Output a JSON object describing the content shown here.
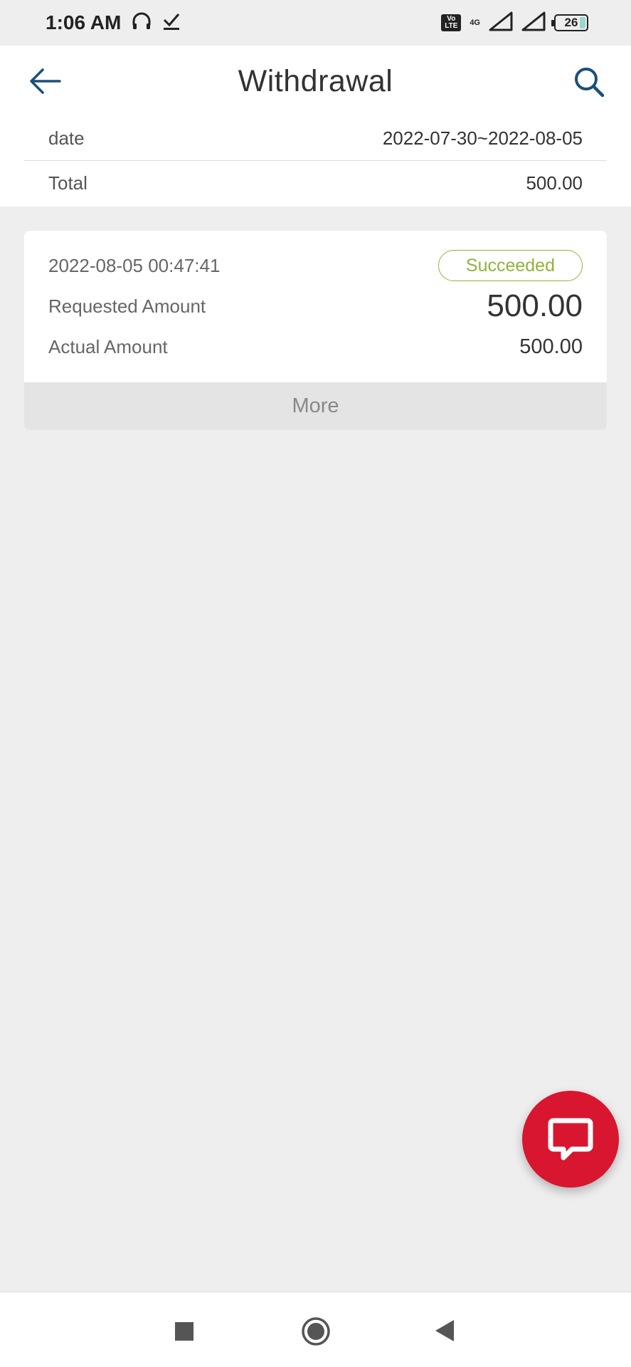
{
  "status_bar": {
    "time": "1:06 AM",
    "volte": "Vo LTE",
    "network": "4G",
    "battery": "26"
  },
  "header": {
    "title": "Withdrawal",
    "date_label": "date",
    "date_value": "2022-07-30~2022-08-05",
    "total_label": "Total",
    "total_value": "500.00"
  },
  "records": [
    {
      "time": "2022-08-05 00:47:41",
      "status": "Succeeded",
      "requested_label": "Requested Amount",
      "requested_value": "500.00",
      "actual_label": "Actual Amount",
      "actual_value": "500.00",
      "more_label": "More"
    }
  ],
  "colors": {
    "accent": "#1b4f7a",
    "status_success": "#8fb33b",
    "chat_fab": "#d9162f"
  },
  "icons": {
    "back": "arrow-left-icon",
    "search": "search-icon",
    "chat": "chat-bubble-icon",
    "headset": "headset-icon",
    "download": "download-done-icon"
  }
}
